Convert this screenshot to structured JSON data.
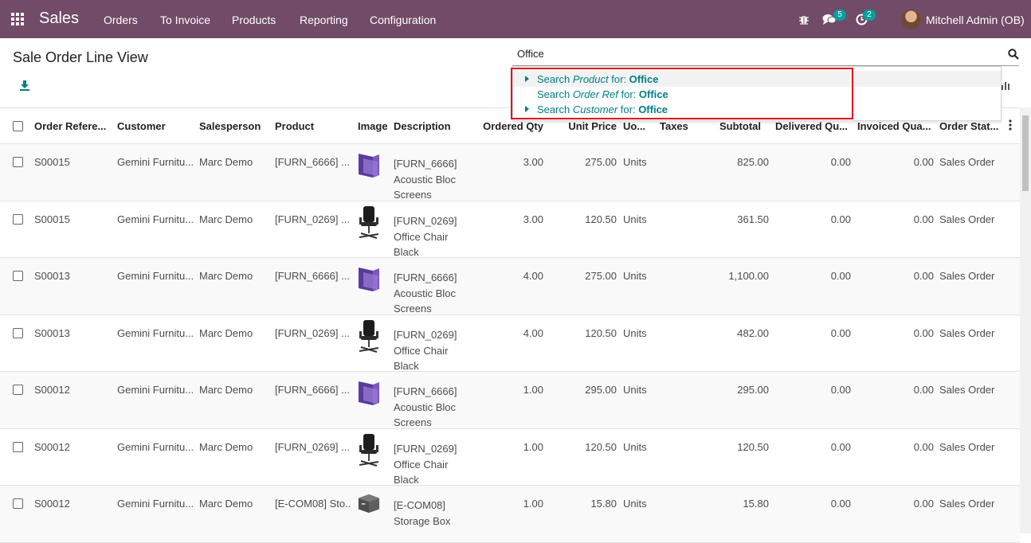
{
  "navbar": {
    "brand": "Sales",
    "menu": [
      "Orders",
      "To Invoice",
      "Products",
      "Reporting",
      "Configuration"
    ],
    "messages_count": "5",
    "activities_count": "2",
    "user_name": "Mitchell Admin (OB)"
  },
  "page": {
    "title": "Sale Order Line View"
  },
  "search": {
    "value": "Office",
    "suggestions": [
      {
        "prefix": "Search ",
        "field": "Product",
        "mid": " for: ",
        "term": "Office"
      },
      {
        "prefix": "Search ",
        "field": "Order Ref",
        "mid": " for: ",
        "term": "Office"
      },
      {
        "prefix": "Search ",
        "field": "Customer",
        "mid": " for: ",
        "term": "Office"
      }
    ]
  },
  "columns": {
    "order_ref": "Order Refere...",
    "customer": "Customer",
    "salesperson": "Salesperson",
    "product": "Product",
    "image": "Image",
    "description": "Description",
    "ordered_qty": "Ordered Qty",
    "unit_price": "Unit Price",
    "uom": "Uo...",
    "taxes": "Taxes",
    "subtotal": "Subtotal",
    "delivered": "Delivered Qu...",
    "invoiced": "Invoiced Qua...",
    "status": "Order Stat..."
  },
  "rows": [
    {
      "ref": "S00015",
      "customer": "Gemini Furnitu...",
      "salesperson": "Marc Demo",
      "product": "[FURN_6666] ...",
      "image": "acoustic-screen",
      "desc": [
        "[FURN_6666]",
        "Acoustic Bloc",
        "Screens"
      ],
      "qty": "3.00",
      "price": "275.00",
      "uom": "Units",
      "subtotal": "825.00",
      "delivered": "0.00",
      "invoiced": "0.00",
      "status": "Sales Order"
    },
    {
      "ref": "S00015",
      "customer": "Gemini Furnitu...",
      "salesperson": "Marc Demo",
      "product": "[FURN_0269] ...",
      "image": "office-chair",
      "desc": [
        "[FURN_0269]",
        "Office Chair",
        "Black"
      ],
      "qty": "3.00",
      "price": "120.50",
      "uom": "Units",
      "subtotal": "361.50",
      "delivered": "0.00",
      "invoiced": "0.00",
      "status": "Sales Order"
    },
    {
      "ref": "S00013",
      "customer": "Gemini Furnitu...",
      "salesperson": "Marc Demo",
      "product": "[FURN_6666] ...",
      "image": "acoustic-screen",
      "desc": [
        "[FURN_6666]",
        "Acoustic Bloc",
        "Screens"
      ],
      "qty": "4.00",
      "price": "275.00",
      "uom": "Units",
      "subtotal": "1,100.00",
      "delivered": "0.00",
      "invoiced": "0.00",
      "status": "Sales Order"
    },
    {
      "ref": "S00013",
      "customer": "Gemini Furnitu...",
      "salesperson": "Marc Demo",
      "product": "[FURN_0269] ...",
      "image": "office-chair",
      "desc": [
        "[FURN_0269]",
        "Office Chair",
        "Black"
      ],
      "qty": "4.00",
      "price": "120.50",
      "uom": "Units",
      "subtotal": "482.00",
      "delivered": "0.00",
      "invoiced": "0.00",
      "status": "Sales Order"
    },
    {
      "ref": "S00012",
      "customer": "Gemini Furnitu...",
      "salesperson": "Marc Demo",
      "product": "[FURN_6666] ...",
      "image": "acoustic-screen",
      "desc": [
        "[FURN_6666]",
        "Acoustic Bloc",
        "Screens"
      ],
      "qty": "1.00",
      "price": "295.00",
      "uom": "Units",
      "subtotal": "295.00",
      "delivered": "0.00",
      "invoiced": "0.00",
      "status": "Sales Order"
    },
    {
      "ref": "S00012",
      "customer": "Gemini Furnitu...",
      "salesperson": "Marc Demo",
      "product": "[FURN_0269] ...",
      "image": "office-chair",
      "desc": [
        "[FURN_0269]",
        "Office Chair",
        "Black"
      ],
      "qty": "1.00",
      "price": "120.50",
      "uom": "Units",
      "subtotal": "120.50",
      "delivered": "0.00",
      "invoiced": "0.00",
      "status": "Sales Order"
    },
    {
      "ref": "S00012",
      "customer": "Gemini Furnitu...",
      "salesperson": "Marc Demo",
      "product": "[E-COM08] Sto...",
      "image": "storage-box",
      "desc": [
        "[E-COM08]",
        "Storage Box"
      ],
      "qty": "1.00",
      "price": "15.80",
      "uom": "Units",
      "subtotal": "15.80",
      "delivered": "0.00",
      "invoiced": "0.00",
      "status": "Sales Order"
    }
  ],
  "colors": {
    "navbar": "#714b67",
    "accent": "#017e84",
    "badge": "#00a09d",
    "highlight": "#e0141e"
  }
}
